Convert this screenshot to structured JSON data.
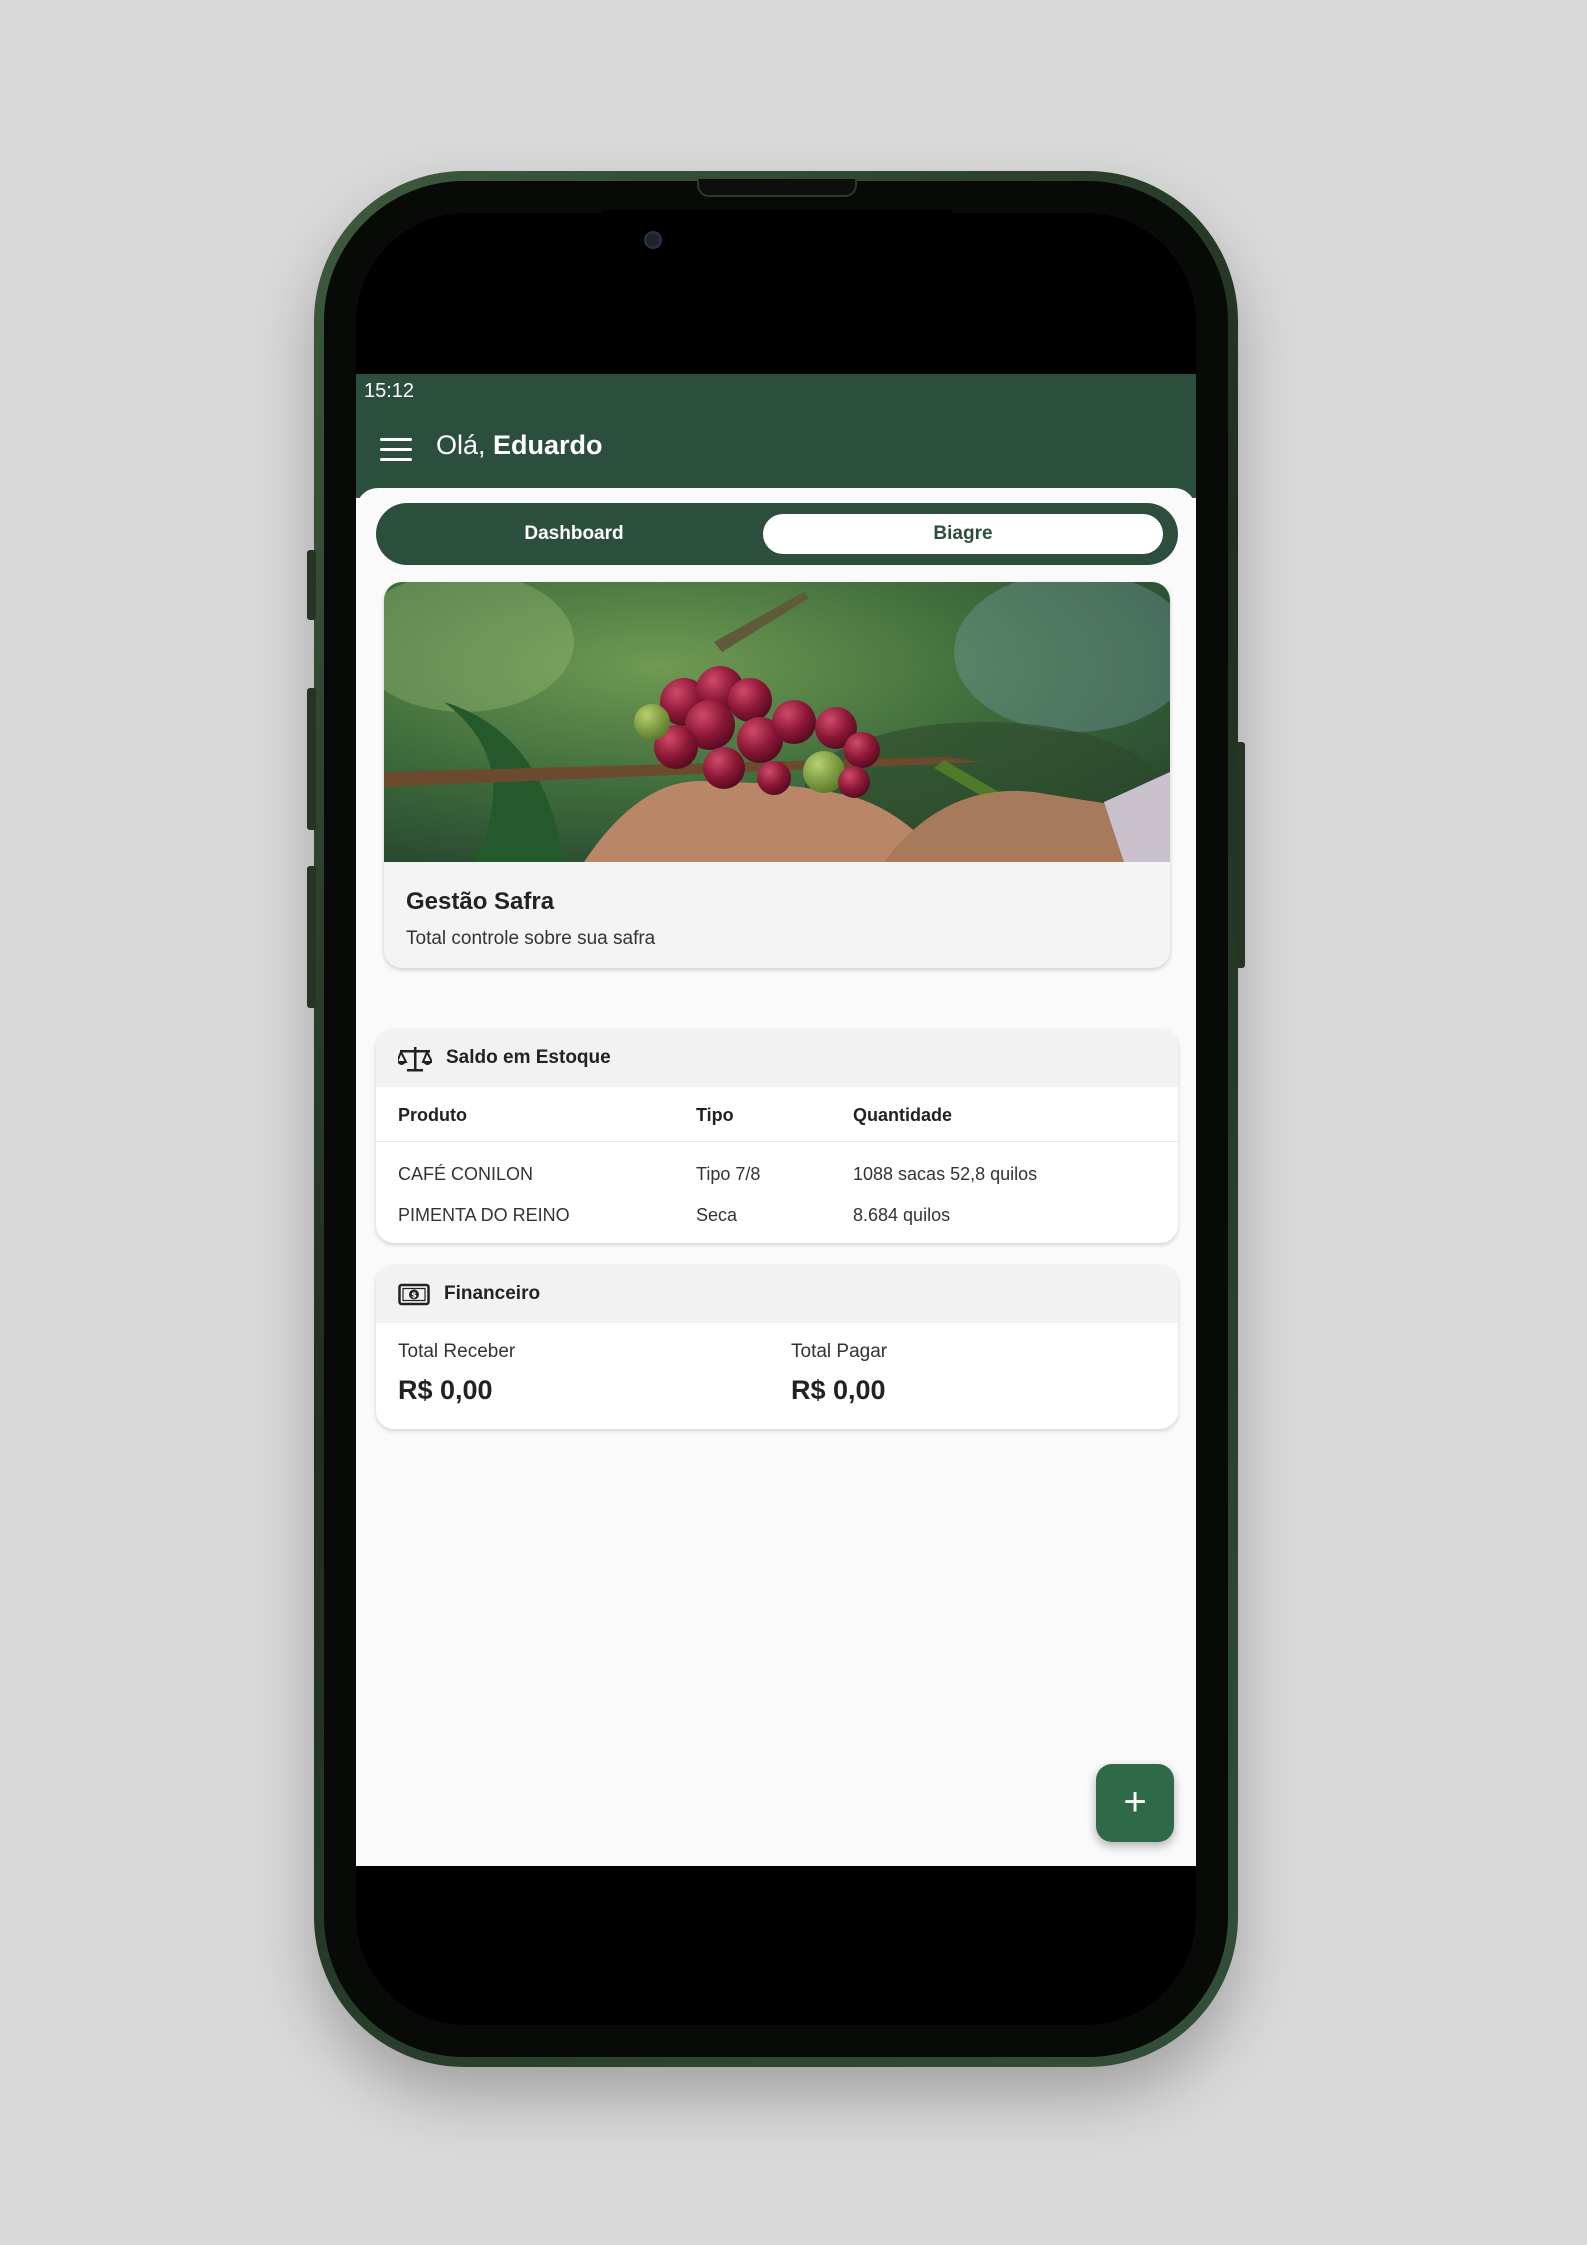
{
  "status_bar": {
    "time": "15:12"
  },
  "header": {
    "greeting_prefix": "Olá, ",
    "user_name": "Eduardo"
  },
  "tabs": [
    {
      "label": "Dashboard",
      "active": false
    },
    {
      "label": "Biagre",
      "active": true
    }
  ],
  "banner": {
    "title": "Gestão Safra",
    "subtitle": "Total controle sobre sua safra",
    "image_icon": "coffee-cherries-photo"
  },
  "stock": {
    "title": "Saldo em Estoque",
    "icon": "scale-icon",
    "columns": [
      "Produto",
      "Tipo",
      "Quantidade"
    ],
    "rows": [
      [
        "CAFÉ CONILON",
        "Tipo 7/8",
        "1088 sacas 52,8 quilos"
      ],
      [
        "PIMENTA DO REINO",
        "Seca",
        "8.684 quilos"
      ]
    ]
  },
  "finance": {
    "title": "Financeiro",
    "icon": "money-bill-icon",
    "receive_label": "Total Receber",
    "receive_value": "R$ 0,00",
    "pay_label": "Total Pagar",
    "pay_value": "R$ 0,00"
  },
  "fab": {
    "label": "+"
  },
  "colors": {
    "primary": "#2c4f3d",
    "fab": "#2f6a48",
    "background": "#fafafa"
  }
}
